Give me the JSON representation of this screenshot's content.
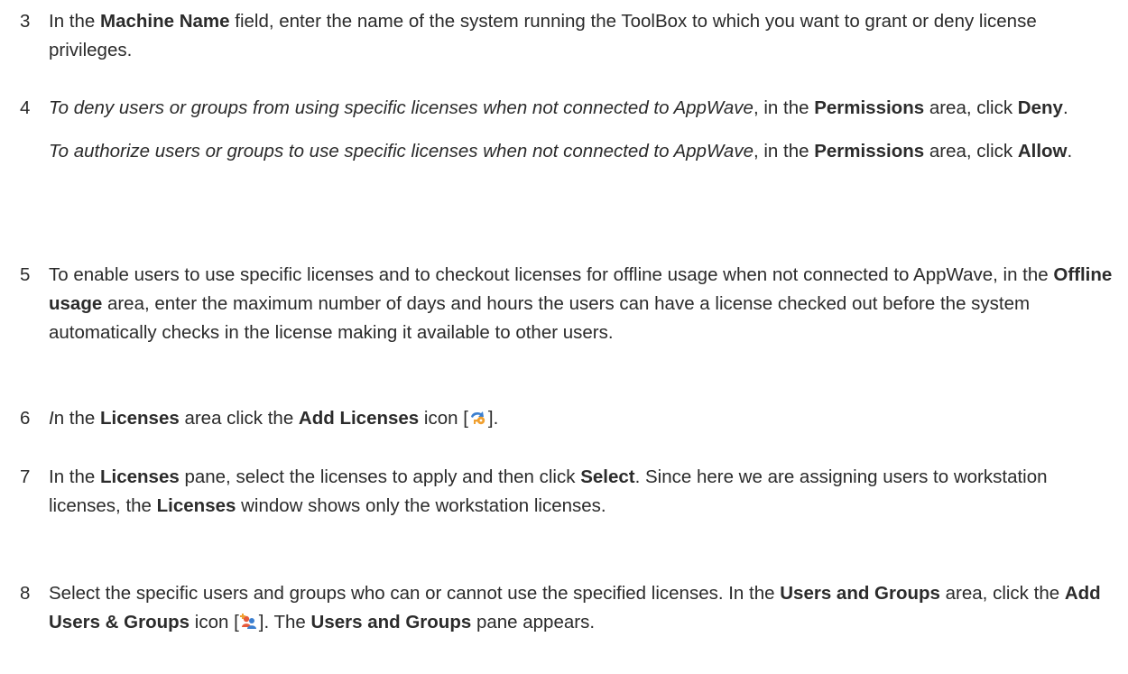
{
  "steps": {
    "s3": {
      "number": "3",
      "a": "In the ",
      "b": "Machine Name",
      "c": " field, enter the name of the system running the ToolBox to which you want to grant or deny license privileges."
    },
    "s4": {
      "number": "4",
      "p1_italic": "To deny users or groups from using specific licenses when not connected to AppWave",
      "p1_a": ", in the ",
      "p1_b": "Permissions",
      "p1_c": " area, click ",
      "p1_d": "Deny",
      "p1_e": ".",
      "p2_italic": "To authorize users or groups to use specific licenses when not connected to AppWave",
      "p2_a": ", in the ",
      "p2_b": "Permissions",
      "p2_c": " area, click ",
      "p2_d": "Allow",
      "p2_e": "."
    },
    "s5": {
      "number": "5",
      "a": "To enable users to use specific licenses and to checkout licenses for offline usage when not connected to AppWave, in the ",
      "b": "Offline usage",
      "c": " area, enter the maximum number of days and hours the users can have a license checked out before the system automatically checks in the license making it available to other users."
    },
    "s6": {
      "number": "6",
      "a_italic": "I",
      "b": "n the ",
      "c": "Licenses",
      "d": " area click the ",
      "e": "Add Licenses",
      "f": " icon [",
      "icon": "add-licenses-icon",
      "g": "]."
    },
    "s7": {
      "number": "7",
      "a": "In the ",
      "b": "Licenses",
      "c": " pane, select the licenses to apply and then click ",
      "d": "Select",
      "e": ". Since here we are assigning users to workstation licenses, the ",
      "f": "Licenses",
      "g": " window shows only the workstation licenses."
    },
    "s8": {
      "number": "8",
      "a": "Select the specific users and groups who can or cannot use the specified licenses. In the ",
      "b": "Users and Groups",
      "c": " area, click the ",
      "d": "Add Users & Groups",
      "e": " icon [",
      "icon": "add-users-groups-icon",
      "f": "]. The ",
      "g": "Users and Groups",
      "h": " pane appears."
    }
  },
  "colors": {
    "text": "#2b2b2b",
    "icon_orange": "#f0a030",
    "icon_blue": "#3b7fd0"
  }
}
